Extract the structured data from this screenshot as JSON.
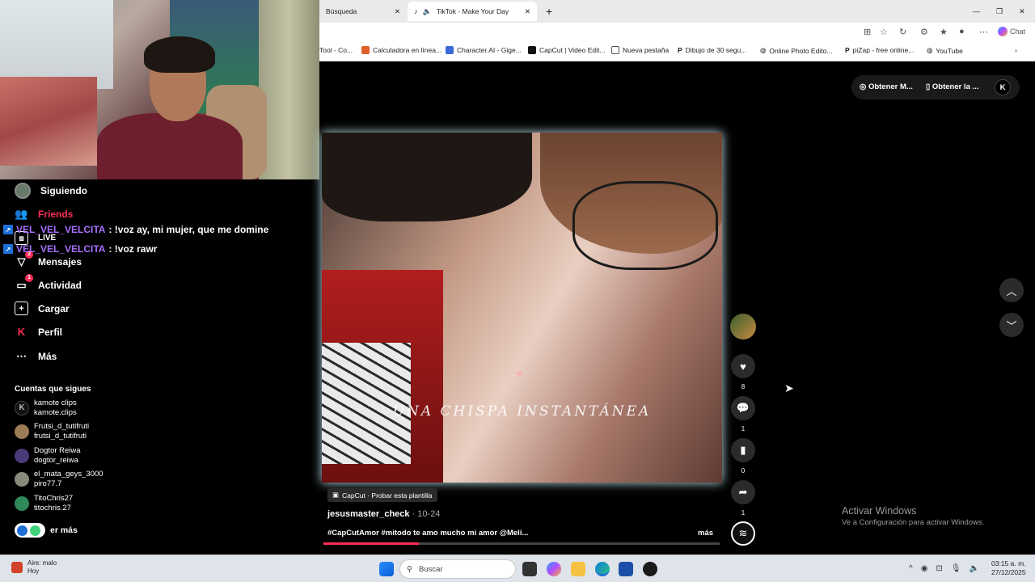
{
  "sidebar": {
    "nav": [
      {
        "label": "Siguiendo",
        "icon": "avatar-icon"
      },
      {
        "label": "Friends",
        "icon": "friends-icon"
      },
      {
        "label": "LIVE",
        "icon": "live-icon"
      },
      {
        "label": "Mensajes",
        "icon": "messages-icon",
        "badge": "2"
      },
      {
        "label": "Actividad",
        "icon": "activity-icon",
        "badge": "1"
      },
      {
        "label": "Cargar",
        "icon": "upload-icon"
      },
      {
        "label": "Perfil",
        "icon": "profile-icon"
      },
      {
        "label": "Más",
        "icon": "more-icon"
      }
    ],
    "following_title": "Cuentas que sigues",
    "following": [
      {
        "name": "kamote clips",
        "handle": "kamote.clips"
      },
      {
        "name": "Frutsi_d_tutifruti",
        "handle": "frutsi_d_tutifruti"
      },
      {
        "name": "Dogtor Reiwa",
        "handle": "dogtor_reiwa"
      },
      {
        "name": "el_mata_geys_3000",
        "handle": "piro77.7"
      },
      {
        "name": "TitoChris27",
        "handle": "titochris.27"
      }
    ],
    "see_more": "er más"
  },
  "chat": [
    {
      "user": "VEL_VEL_VELCITA",
      "message": ": !voz ay, mi mujer, que me domine"
    },
    {
      "user": "VEL_VEL_VELCITA",
      "message": ": !voz rawr"
    }
  ],
  "browser": {
    "tabs": [
      {
        "label": "Búsqueda"
      },
      {
        "label": "TikTok - Make Your Day"
      }
    ],
    "chat_label": "Chat",
    "bookmarks": [
      {
        "label": "Tool - Co..."
      },
      {
        "label": "Calculadora en línea..."
      },
      {
        "label": "Character.AI - Gige..."
      },
      {
        "label": "CapCut | Video Edit..."
      },
      {
        "label": "Nueva pestaña"
      },
      {
        "label": "Dibujo de 30 segu..."
      },
      {
        "label": "Online Photo Edito..."
      },
      {
        "label": "piZap - free online..."
      },
      {
        "label": "YouTube"
      }
    ]
  },
  "tiktok": {
    "top_buttons": [
      "Obtener M...",
      "Obtener la ..."
    ],
    "video_caption": "UNA CHISPA INSTANTÁNEA",
    "capcut_pill": "CapCut · Probar esta plantilla",
    "author": "jesusmaster_check",
    "date": " · 10-24",
    "description": "#CapCutAmor #mitodo te amo mucho mi amor @Meli...",
    "more": "más",
    "progress": 0.24,
    "likes": "8",
    "comments": "1",
    "saves": "0",
    "shares": "1"
  },
  "windows": {
    "activate_title": "Activar Windows",
    "activate_sub": "Ve a Configuración para activar Windows."
  },
  "taskbar": {
    "weather_title": "Aire: malo",
    "weather_sub": "Hoy",
    "search_placeholder": "Buscar",
    "time": "03:15 a. m.",
    "date": "27/12/2025"
  }
}
